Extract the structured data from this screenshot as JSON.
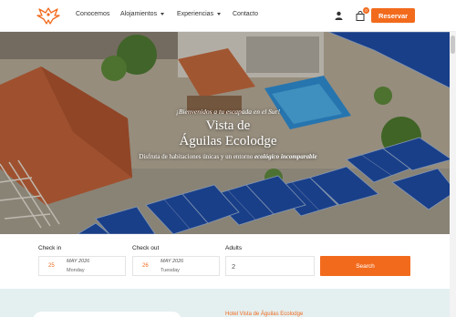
{
  "nav": {
    "logo_icon": "eagle-logo-icon",
    "items": [
      {
        "label": "Conocemos",
        "dropdown": false
      },
      {
        "label": "Alojamientos",
        "dropdown": true
      },
      {
        "label": "Experiencias",
        "dropdown": true
      },
      {
        "label": "Contacto",
        "dropdown": false
      }
    ],
    "user_icon": "user-icon",
    "cart_icon": "shopping-bag-icon",
    "cart_count": "0",
    "reserve_label": "Reservar"
  },
  "hero": {
    "kicker": "¡Bienvenidos a tu escapada en el Sur!",
    "title_line1": "Vista de",
    "title_line2": "Águilas Ecolodge",
    "subtitle_prefix": "Disfruta de habitaciones únicas y un entorno ",
    "subtitle_emphasis": "ecológico incomparable"
  },
  "booking": {
    "checkin_label": "Check in",
    "checkin_day": "25",
    "checkin_month": "MAY",
    "checkin_year": "2026",
    "checkin_weekday": "Monday",
    "checkout_label": "Check out",
    "checkout_day": "26",
    "checkout_month": "MAY",
    "checkout_year": "2026",
    "checkout_weekday": "Tuesday",
    "adults_label": "Adults",
    "adults_value": "2",
    "search_label": "Search"
  },
  "section": {
    "title": "Hotel Vista de Águilas Ecolodge"
  },
  "colors": {
    "accent": "#f26b1d",
    "section_bg": "#e4eff0"
  }
}
